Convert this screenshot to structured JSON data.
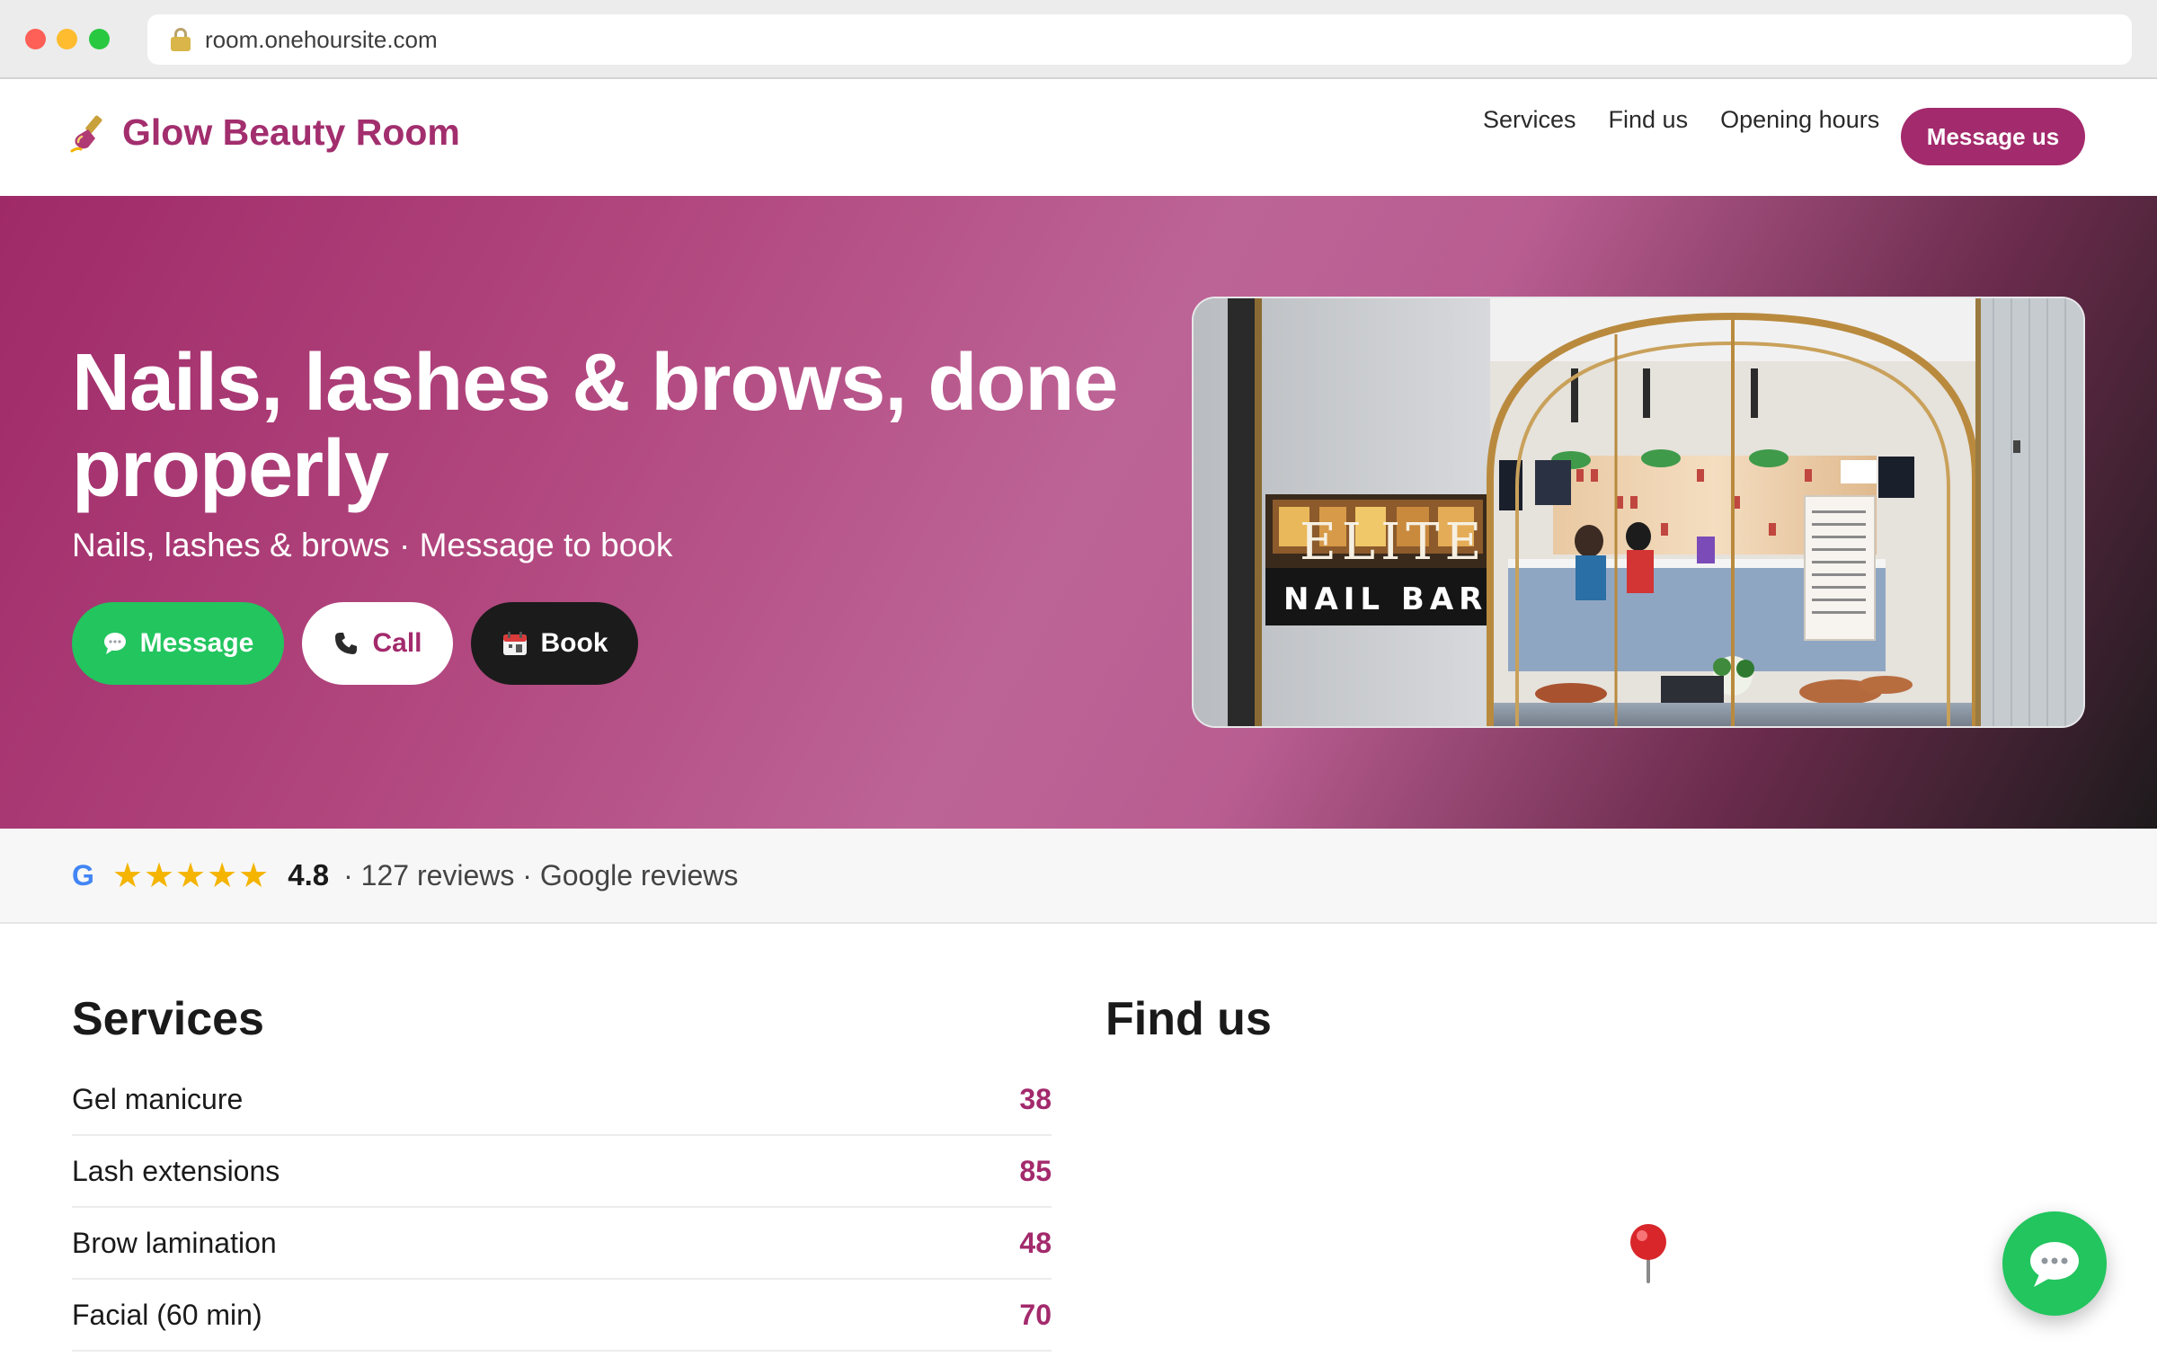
{
  "browser": {
    "url": "room.onehoursite.com"
  },
  "nav": {
    "brand_icon": "nail-polish-icon",
    "brand_name": "Glow Beauty Room",
    "links": [
      {
        "label": "Services"
      },
      {
        "label": "Find us"
      },
      {
        "label": "Opening hours"
      }
    ],
    "cta_label": "Message us"
  },
  "hero": {
    "title": "Nails, lashes & brows, done properly",
    "subtitle": "Nails, lashes & brows · Message to book",
    "buttons": {
      "message": {
        "label": "Message",
        "icon": "speech-bubble-icon"
      },
      "call": {
        "label": "Call",
        "icon": "phone-icon"
      },
      "book": {
        "label": "Book",
        "icon": "calendar-icon"
      }
    },
    "photo_sign": {
      "line1": "ELITE",
      "line2": "NAIL BAR"
    }
  },
  "reviews": {
    "source_icon": "G",
    "stars": "★★★★★",
    "rating": "4.8",
    "meta": "· 127 reviews · Google reviews"
  },
  "services": {
    "title": "Services",
    "items": [
      {
        "name": "Gel manicure",
        "price": "38"
      },
      {
        "name": "Lash extensions",
        "price": "85"
      },
      {
        "name": "Brow lamination",
        "price": "48"
      },
      {
        "name": "Facial (60 min)",
        "price": "70"
      }
    ]
  },
  "find_us": {
    "title": "Find us",
    "pin_icon": "map-pin-icon"
  },
  "chat_fab": {
    "icon": "chat-bubble-icon"
  },
  "colors": {
    "brand": "#a32a6c",
    "whatsapp_green": "#22c55e",
    "star": "#f4b400",
    "google_blue": "#4285f4"
  }
}
